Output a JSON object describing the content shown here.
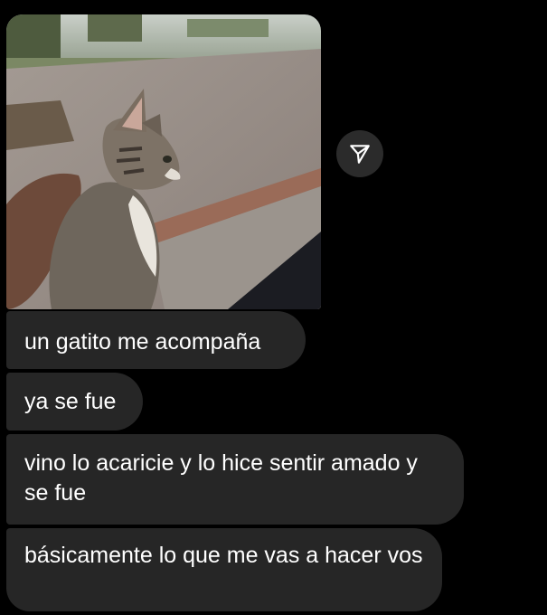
{
  "messages": [
    {
      "text": "un gatito me acompaña"
    },
    {
      "text": "ya se fue"
    },
    {
      "text": "vino lo acaricie y lo hice sentir amado y se fue"
    },
    {
      "text": "básicamente lo que me vas a hacer vos"
    }
  ],
  "icons": {
    "share": "paper-plane-icon"
  },
  "colors": {
    "background": "#000000",
    "bubble": "#262626",
    "text": "#ffffff",
    "share_button": "#2b2b2b"
  }
}
